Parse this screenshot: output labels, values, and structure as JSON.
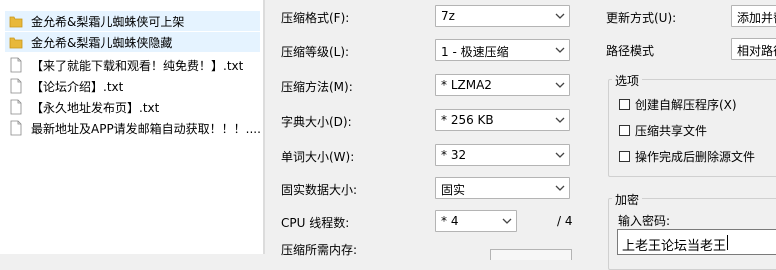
{
  "file_list": {
    "items": [
      {
        "name": "金允希&梨霜儿蜘蛛侠可上架",
        "icon": "folder-icon",
        "selected": true
      },
      {
        "name": "金允希&梨霜儿蜘蛛侠隐藏",
        "icon": "folder-icon",
        "selected": true
      },
      {
        "name": "【来了就能下载和观看！纯免费！】.txt",
        "icon": "text-file-icon",
        "selected": false
      },
      {
        "name": "【论坛介绍】.txt",
        "icon": "text-file-icon",
        "selected": false
      },
      {
        "name": "【永久地址发布页】.txt",
        "icon": "text-file-icon",
        "selected": false
      },
      {
        "name": "最新地址及APP请发邮箱自动获取！！！....",
        "icon": "text-file-icon",
        "selected": false
      }
    ]
  },
  "dialog": {
    "format": {
      "label": "压缩格式(F):",
      "value": "7z"
    },
    "level": {
      "label": "压缩等级(L):",
      "value": "1 - 极速压缩"
    },
    "method": {
      "label": "压缩方法(M):",
      "value": "* LZMA2"
    },
    "dict": {
      "label": "字典大小(D):",
      "value": "* 256 KB"
    },
    "word": {
      "label": "单词大小(W):",
      "value": "* 32"
    },
    "solid": {
      "label": "固实数据大小:",
      "value": "固实"
    },
    "threads": {
      "label": "CPU 线程数:",
      "value": "* 4",
      "max": "/ 4"
    },
    "memory": {
      "label": "压缩所需内存:"
    },
    "update": {
      "label": "更新方式(U):",
      "value": "添加并替"
    },
    "path": {
      "label": "路径模式",
      "value": "相对路径"
    },
    "options": {
      "title": "选项",
      "sfx": "创建自解压程序(X)",
      "shared": "压缩共享文件",
      "delete": "操作完成后删除源文件"
    },
    "encryption": {
      "title": "加密",
      "password_label": "输入密码:",
      "password_value": "上老王论坛当老王"
    }
  }
}
